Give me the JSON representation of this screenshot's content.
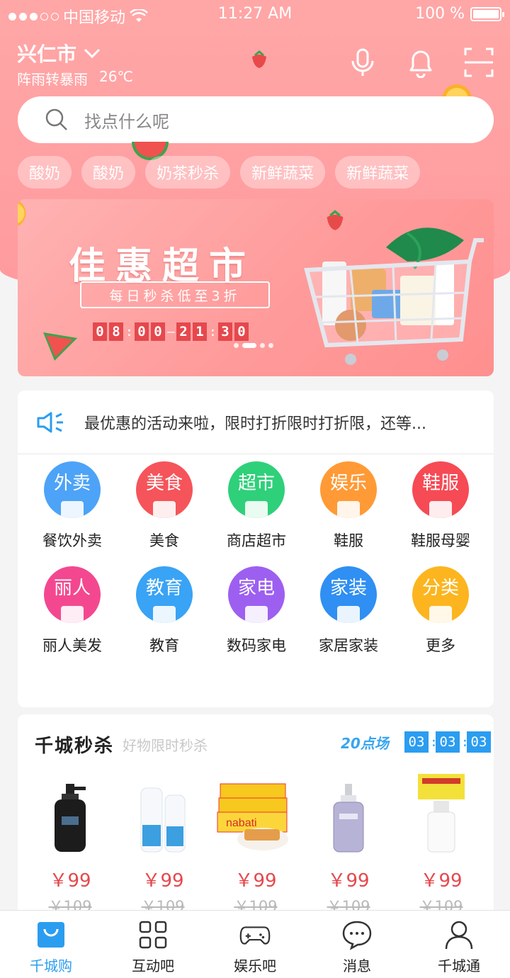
{
  "status_bar": {
    "carrier": "中国移动",
    "time": "11:27 AM",
    "battery": "100 %"
  },
  "header": {
    "city": "兴仁市",
    "weather": "阵雨转暴雨",
    "temperature": "26℃",
    "icons": [
      "microphone-icon",
      "bell-icon",
      "scan-icon"
    ]
  },
  "search": {
    "placeholder": "找点什么呢"
  },
  "tags": [
    "酸奶",
    "酸奶",
    "奶茶秒杀",
    "新鲜蔬菜",
    "新鲜蔬菜"
  ],
  "banner": {
    "title": "佳惠超市",
    "subtitle": "每日秒杀低至3折",
    "timer": {
      "start": [
        "0",
        "8",
        "0",
        "0"
      ],
      "end": [
        "2",
        "1",
        "3",
        "0"
      ]
    },
    "page_count": 4,
    "active_page": 1
  },
  "notice": {
    "icon": "speaker-icon",
    "text": "最优惠的活动来啦，限时打折限时打折限，还等..."
  },
  "categories": [
    {
      "badge": "外卖",
      "label": "餐饮外卖",
      "color": "#4da3f7"
    },
    {
      "badge": "美食",
      "label": "美食",
      "color": "#f5545a"
    },
    {
      "badge": "超市",
      "label": "商店超市",
      "color": "#2fd07a"
    },
    {
      "badge": "娱乐",
      "label": "鞋服",
      "color": "#ff9a36"
    },
    {
      "badge": "鞋服",
      "label": "鞋服母婴",
      "color": "#f64a55"
    },
    {
      "badge": "丽人",
      "label": "丽人美发",
      "color": "#f3488f"
    },
    {
      "badge": "教育",
      "label": "教育",
      "color": "#39a3f5"
    },
    {
      "badge": "家电",
      "label": "数码家电",
      "color": "#9d5ff0"
    },
    {
      "badge": "家装",
      "label": "家居家装",
      "color": "#2f8ff2"
    },
    {
      "badge": "分类",
      "label": "更多",
      "color": "#fcb51e"
    }
  ],
  "flash_sale": {
    "title": "千城秒杀",
    "subtitle": "好物限时秒杀",
    "round": "20点场",
    "timer": [
      "03",
      "03",
      "03"
    ],
    "products": [
      {
        "price": "￥99",
        "old_price": "￥109",
        "image": "body-wash-bottle"
      },
      {
        "price": "￥99",
        "old_price": "￥109",
        "image": "spray-bottles"
      },
      {
        "price": "￥99",
        "old_price": "￥109",
        "image": "wafer-biscuits"
      },
      {
        "price": "￥99",
        "old_price": "￥109",
        "image": "serum-bottle"
      },
      {
        "price": "￥99",
        "old_price": "￥109",
        "image": "lotion-bottle"
      }
    ]
  },
  "tabbar": [
    {
      "label": "千城购",
      "icon": "shopping-bag-icon",
      "active": true
    },
    {
      "label": "互动吧",
      "icon": "apps-grid-icon",
      "active": false
    },
    {
      "label": "娱乐吧",
      "icon": "gamepad-icon",
      "active": false
    },
    {
      "label": "消息",
      "icon": "chat-bubble-icon",
      "active": false
    },
    {
      "label": "千城通",
      "icon": "user-icon",
      "active": false
    }
  ],
  "colors": {
    "header": "#ff9a9e",
    "accent_blue": "#2b9df0",
    "price_red": "#e5484d"
  }
}
